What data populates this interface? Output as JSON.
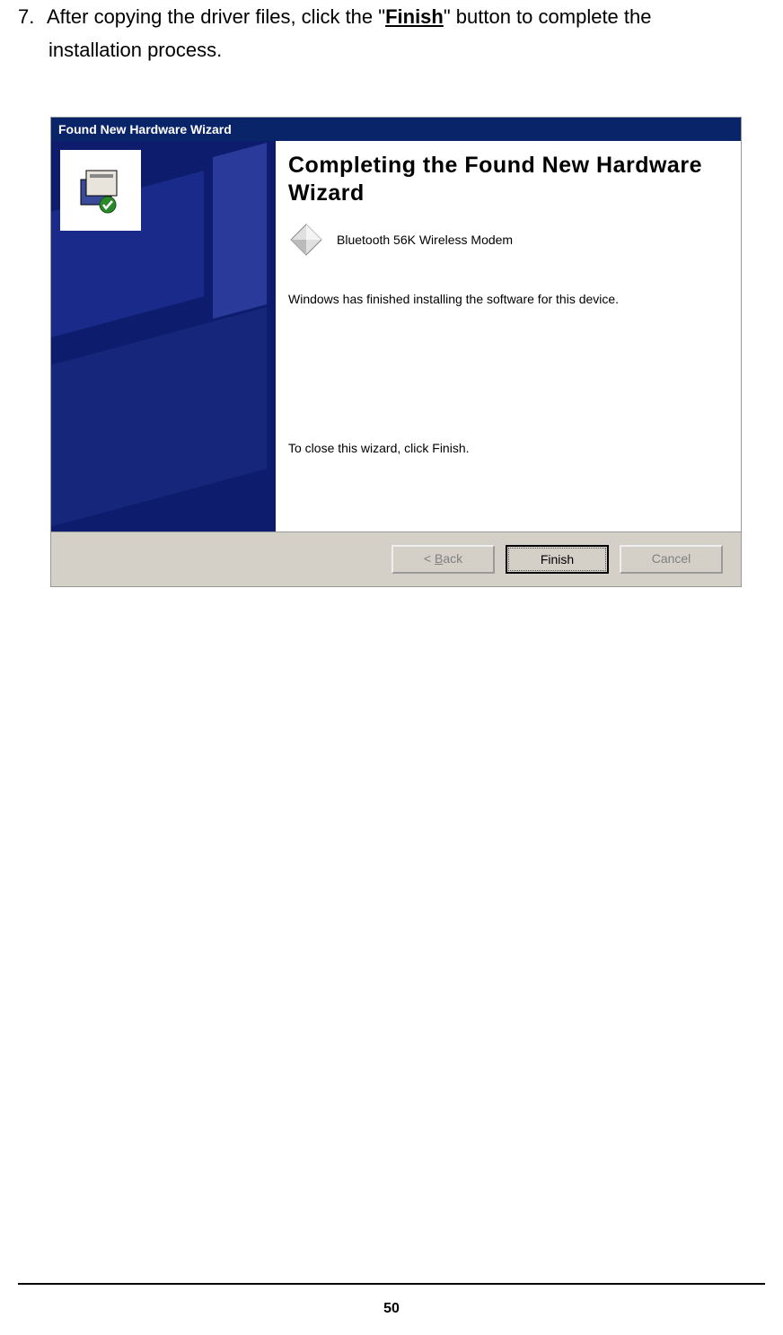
{
  "document": {
    "step_number": "7.",
    "step_text_prefix": "After copying the driver files, click the \"",
    "step_bold": "Finish",
    "step_text_suffix": "\" button to complete the",
    "step_line2": "installation process.",
    "page_number": "50"
  },
  "wizard": {
    "title": "Found New Hardware Wizard",
    "heading": "Completing the Found New Hardware Wizard",
    "device_name": "Bluetooth 56K Wireless Modem",
    "status_text": "Windows has finished installing the software for this device.",
    "close_text": "To close this wizard, click Finish.",
    "buttons": {
      "back_prefix": "< ",
      "back_u": "B",
      "back_rest": "ack",
      "finish": "Finish",
      "cancel": "Cancel"
    }
  }
}
